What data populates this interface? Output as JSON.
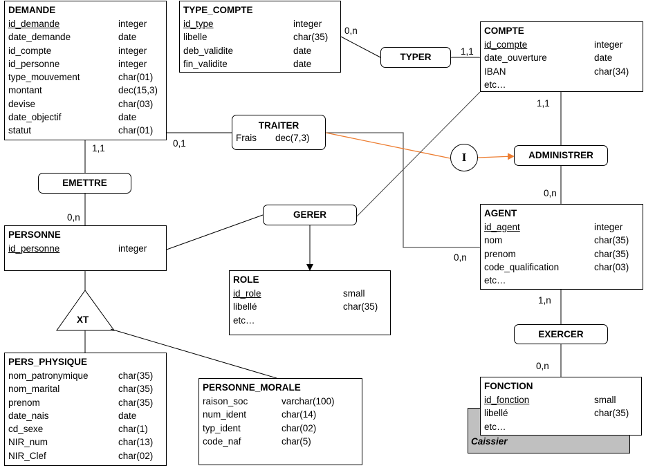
{
  "entities": [
    {
      "id": "demande",
      "name": "DEMANDE",
      "attributes": [
        {
          "name": "id_demande",
          "type": "integer",
          "pk": true
        },
        {
          "name": "date_demande",
          "type": "date"
        },
        {
          "name": "id_compte",
          "type": "integer"
        },
        {
          "name": "id_personne",
          "type": "integer"
        },
        {
          "name": "type_mouvement",
          "type": "char(01)"
        },
        {
          "name": "montant",
          "type": "dec(15,3)"
        },
        {
          "name": "devise",
          "type": "char(03)"
        },
        {
          "name": "date_objectif",
          "type": "date"
        },
        {
          "name": "statut",
          "type": "char(01)"
        }
      ]
    },
    {
      "id": "type_compte",
      "name": "TYPE_COMPTE",
      "attributes": [
        {
          "name": "id_type",
          "type": "integer",
          "pk": true
        },
        {
          "name": "libelle",
          "type": "char(35)"
        },
        {
          "name": "deb_validite",
          "type": "date"
        },
        {
          "name": "fin_validite",
          "type": "date"
        }
      ]
    },
    {
      "id": "compte",
      "name": "COMPTE",
      "attributes": [
        {
          "name": "id_compte",
          "type": "integer",
          "pk": true
        },
        {
          "name": "date_ouverture",
          "type": "date"
        },
        {
          "name": "IBAN",
          "type": "char(34)"
        },
        {
          "name": "etc…",
          "type": ""
        }
      ]
    },
    {
      "id": "agent",
      "name": "AGENT",
      "attributes": [
        {
          "name": "id_agent",
          "type": "integer",
          "pk": true
        },
        {
          "name": "nom",
          "type": "char(35)"
        },
        {
          "name": "prenom",
          "type": "char(35)"
        },
        {
          "name": "code_qualification",
          "type": "char(03)"
        },
        {
          "name": "etc…",
          "type": ""
        }
      ]
    },
    {
      "id": "fonction",
      "name": "FONCTION",
      "attributes": [
        {
          "name": "id_fonction",
          "type": "small",
          "pk": true
        },
        {
          "name": "libellé",
          "type": "char(35)"
        },
        {
          "name": "etc…",
          "type": ""
        }
      ]
    },
    {
      "id": "personne",
      "name": "PERSONNE",
      "attributes": [
        {
          "name": "id_personne",
          "type": "integer",
          "pk": true
        }
      ]
    },
    {
      "id": "role",
      "name": "ROLE",
      "attributes": [
        {
          "name": "id_role",
          "type": "small",
          "pk": true
        },
        {
          "name": "libellé",
          "type": "char(35)"
        },
        {
          "name": "etc…",
          "type": ""
        }
      ]
    },
    {
      "id": "pers_physique",
      "name": "PERS_PHYSIQUE",
      "attributes": [
        {
          "name": "nom_patronymique",
          "type": "char(35)"
        },
        {
          "name": "nom_marital",
          "type": "char(35)"
        },
        {
          "name": "prenom",
          "type": "char(35)"
        },
        {
          "name": "date_nais",
          "type": "date"
        },
        {
          "name": "cd_sexe",
          "type": "char(1)"
        },
        {
          "name": "NIR_num",
          "type": "char(13)"
        },
        {
          "name": "NIR_Clef",
          "type": "char(02)"
        }
      ]
    },
    {
      "id": "personne_morale",
      "name": "PERSONNE_MORALE",
      "attributes": [
        {
          "name": "raison_soc",
          "type": "varchar(100)"
        },
        {
          "name": "num_ident",
          "type": "char(14)"
        },
        {
          "name": "typ_ident",
          "type": "char(02)"
        },
        {
          "name": "code_naf",
          "type": "char(5)"
        }
      ]
    }
  ],
  "fonction_instance": "Caissier",
  "relations": [
    {
      "id": "typer",
      "name": "TYPER"
    },
    {
      "id": "traiter",
      "name": "TRAITER",
      "attribute": {
        "name": "Frais",
        "type": "dec(7,3)"
      }
    },
    {
      "id": "emettre",
      "name": "EMETTRE"
    },
    {
      "id": "gerer",
      "name": "GERER"
    },
    {
      "id": "administrer",
      "name": "ADMINISTRER"
    },
    {
      "id": "exercer",
      "name": "EXERCER"
    }
  ],
  "inheritance_label": "XT",
  "constraint_label": "I",
  "cardinalities": [
    {
      "id": "tc-typer",
      "value": "0,n"
    },
    {
      "id": "compte-typer",
      "value": "1,1"
    },
    {
      "id": "demande-traiter",
      "value": "0,1"
    },
    {
      "id": "demande-emettre",
      "value": "1,1"
    },
    {
      "id": "personne-emettre",
      "value": "0,n"
    },
    {
      "id": "agent-traiter",
      "value": "0,n"
    },
    {
      "id": "compte-administrer",
      "value": "1,1"
    },
    {
      "id": "agent-administrer",
      "value": "0,n"
    },
    {
      "id": "agent-exercer",
      "value": "1,n"
    },
    {
      "id": "fonction-exercer",
      "value": "0,n"
    }
  ],
  "colors": {
    "line": "#000000",
    "constraint_arrow": "#ED7D31",
    "shadow": "#C0C0C0",
    "gray_link": "#595959"
  }
}
